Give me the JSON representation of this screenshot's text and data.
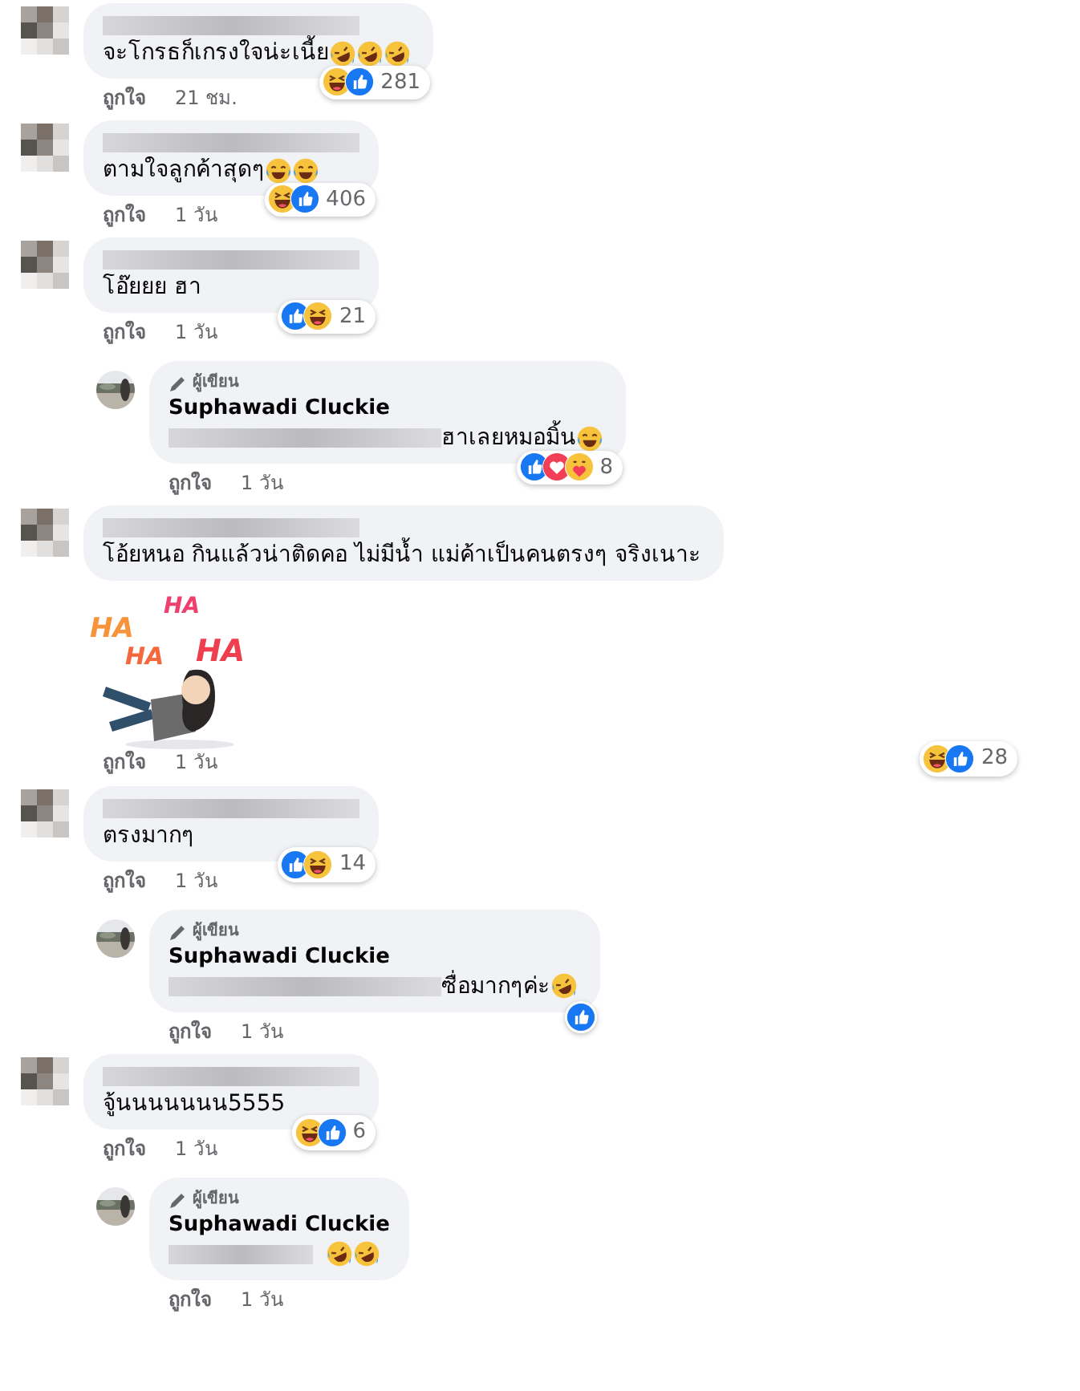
{
  "comments": [
    {
      "kind": "comment",
      "text": "จะโกรธก็เกรงใจน่ะเนี้ย",
      "emojis": [
        {
          "kind": "rofl"
        },
        {
          "kind": "rofl"
        },
        {
          "kind": "rofl"
        }
      ],
      "reactions": [
        {
          "kind": "haha"
        },
        {
          "kind": "like"
        }
      ],
      "count": "281",
      "like_label": "ถูกใจ",
      "time": "21 ชม."
    },
    {
      "kind": "comment",
      "text": "ตามใจลูกค้าสุดๆ",
      "emojis": [
        {
          "kind": "joy"
        },
        {
          "kind": "joy"
        }
      ],
      "reactions": [
        {
          "kind": "haha"
        },
        {
          "kind": "like"
        }
      ],
      "count": "406",
      "like_label": "ถูกใจ",
      "time": "1 วัน"
    },
    {
      "kind": "comment",
      "text": "โอ๊ยยย ฮา",
      "reactions": [
        {
          "kind": "like"
        },
        {
          "kind": "haha"
        }
      ],
      "count": "21",
      "like_label": "ถูกใจ",
      "time": "1 วัน"
    },
    {
      "kind": "reply",
      "author_badge": "ผู้เขียน",
      "name": "Suphawadi Cluckie",
      "blurred_prefix": true,
      "text": "ฮาเลยหมอมิ้น",
      "emojis": [
        {
          "kind": "joy"
        }
      ],
      "reactions": [
        {
          "kind": "like"
        },
        {
          "kind": "love"
        },
        {
          "kind": "care"
        }
      ],
      "count": "8",
      "like_label": "ถูกใจ",
      "time": "1 วัน"
    },
    {
      "kind": "comment",
      "text": "โอ้ยหนอ กินแล้วน่าติดคอ ไม่มีน้ำ แม่ค้าเป็นคนตรงๆ จริงเนาะ",
      "sticker": {
        "texts": [
          "HA",
          "HA",
          "HA",
          "HA"
        ]
      },
      "reactions": [
        {
          "kind": "haha"
        },
        {
          "kind": "like"
        }
      ],
      "count": "28",
      "like_label": "ถูกใจ",
      "time": "1 วัน"
    },
    {
      "kind": "comment",
      "text": "ตรงมากๆ",
      "reactions": [
        {
          "kind": "like"
        },
        {
          "kind": "haha"
        }
      ],
      "count": "14",
      "like_label": "ถูกใจ",
      "time": "1 วัน"
    },
    {
      "kind": "reply",
      "author_badge": "ผู้เขียน",
      "name": "Suphawadi Cluckie",
      "blurred_prefix": true,
      "text": "ซื่อมากๆค่ะ",
      "emojis": [
        {
          "kind": "rofl"
        }
      ],
      "reactions": [
        {
          "kind": "like"
        }
      ],
      "like_label": "ถูกใจ",
      "time": "1 วัน"
    },
    {
      "kind": "comment",
      "text": "จู้นนนนนนน5555",
      "reactions": [
        {
          "kind": "haha"
        },
        {
          "kind": "like"
        }
      ],
      "count": "6",
      "like_label": "ถูกใจ",
      "time": "1 วัน"
    },
    {
      "kind": "reply",
      "author_badge": "ผู้เขียน",
      "name": "Suphawadi Cluckie",
      "blurred_prefix": true,
      "emojis": [
        {
          "kind": "rofl"
        },
        {
          "kind": "rofl"
        }
      ],
      "like_label": "ถูกใจ",
      "time": "1 วัน"
    }
  ]
}
